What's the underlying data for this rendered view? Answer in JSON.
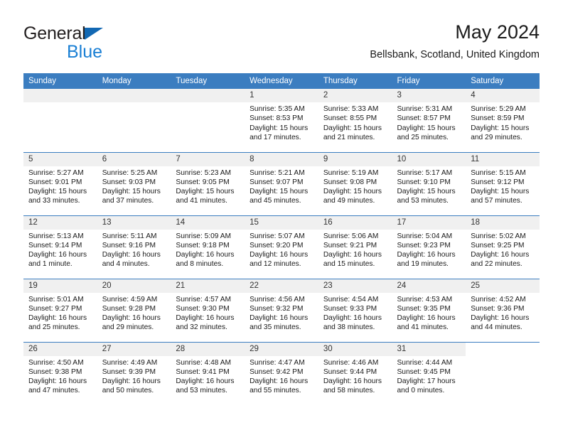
{
  "brand": {
    "name_part1": "General",
    "name_part2": "Blue",
    "triangle_color": "#1268b3",
    "blue_color": "#1a7fd4"
  },
  "header": {
    "title": "May 2024",
    "subtitle": "Bellsbank, Scotland, United Kingdom"
  },
  "theme": {
    "header_blue": "#3b7dc0",
    "daynum_bg": "#f0f0f0"
  },
  "calendar": {
    "weekday_headers": [
      "Sunday",
      "Monday",
      "Tuesday",
      "Wednesday",
      "Thursday",
      "Friday",
      "Saturday"
    ],
    "weeks": [
      [
        {
          "day": "",
          "empty": true
        },
        {
          "day": "",
          "empty": true
        },
        {
          "day": "",
          "empty": true
        },
        {
          "day": "1",
          "sunrise": "Sunrise: 5:35 AM",
          "sunset": "Sunset: 8:53 PM",
          "daylight": "Daylight: 15 hours and 17 minutes."
        },
        {
          "day": "2",
          "sunrise": "Sunrise: 5:33 AM",
          "sunset": "Sunset: 8:55 PM",
          "daylight": "Daylight: 15 hours and 21 minutes."
        },
        {
          "day": "3",
          "sunrise": "Sunrise: 5:31 AM",
          "sunset": "Sunset: 8:57 PM",
          "daylight": "Daylight: 15 hours and 25 minutes."
        },
        {
          "day": "4",
          "sunrise": "Sunrise: 5:29 AM",
          "sunset": "Sunset: 8:59 PM",
          "daylight": "Daylight: 15 hours and 29 minutes."
        }
      ],
      [
        {
          "day": "5",
          "sunrise": "Sunrise: 5:27 AM",
          "sunset": "Sunset: 9:01 PM",
          "daylight": "Daylight: 15 hours and 33 minutes."
        },
        {
          "day": "6",
          "sunrise": "Sunrise: 5:25 AM",
          "sunset": "Sunset: 9:03 PM",
          "daylight": "Daylight: 15 hours and 37 minutes."
        },
        {
          "day": "7",
          "sunrise": "Sunrise: 5:23 AM",
          "sunset": "Sunset: 9:05 PM",
          "daylight": "Daylight: 15 hours and 41 minutes."
        },
        {
          "day": "8",
          "sunrise": "Sunrise: 5:21 AM",
          "sunset": "Sunset: 9:07 PM",
          "daylight": "Daylight: 15 hours and 45 minutes."
        },
        {
          "day": "9",
          "sunrise": "Sunrise: 5:19 AM",
          "sunset": "Sunset: 9:08 PM",
          "daylight": "Daylight: 15 hours and 49 minutes."
        },
        {
          "day": "10",
          "sunrise": "Sunrise: 5:17 AM",
          "sunset": "Sunset: 9:10 PM",
          "daylight": "Daylight: 15 hours and 53 minutes."
        },
        {
          "day": "11",
          "sunrise": "Sunrise: 5:15 AM",
          "sunset": "Sunset: 9:12 PM",
          "daylight": "Daylight: 15 hours and 57 minutes."
        }
      ],
      [
        {
          "day": "12",
          "sunrise": "Sunrise: 5:13 AM",
          "sunset": "Sunset: 9:14 PM",
          "daylight": "Daylight: 16 hours and 1 minute."
        },
        {
          "day": "13",
          "sunrise": "Sunrise: 5:11 AM",
          "sunset": "Sunset: 9:16 PM",
          "daylight": "Daylight: 16 hours and 4 minutes."
        },
        {
          "day": "14",
          "sunrise": "Sunrise: 5:09 AM",
          "sunset": "Sunset: 9:18 PM",
          "daylight": "Daylight: 16 hours and 8 minutes."
        },
        {
          "day": "15",
          "sunrise": "Sunrise: 5:07 AM",
          "sunset": "Sunset: 9:20 PM",
          "daylight": "Daylight: 16 hours and 12 minutes."
        },
        {
          "day": "16",
          "sunrise": "Sunrise: 5:06 AM",
          "sunset": "Sunset: 9:21 PM",
          "daylight": "Daylight: 16 hours and 15 minutes."
        },
        {
          "day": "17",
          "sunrise": "Sunrise: 5:04 AM",
          "sunset": "Sunset: 9:23 PM",
          "daylight": "Daylight: 16 hours and 19 minutes."
        },
        {
          "day": "18",
          "sunrise": "Sunrise: 5:02 AM",
          "sunset": "Sunset: 9:25 PM",
          "daylight": "Daylight: 16 hours and 22 minutes."
        }
      ],
      [
        {
          "day": "19",
          "sunrise": "Sunrise: 5:01 AM",
          "sunset": "Sunset: 9:27 PM",
          "daylight": "Daylight: 16 hours and 25 minutes."
        },
        {
          "day": "20",
          "sunrise": "Sunrise: 4:59 AM",
          "sunset": "Sunset: 9:28 PM",
          "daylight": "Daylight: 16 hours and 29 minutes."
        },
        {
          "day": "21",
          "sunrise": "Sunrise: 4:57 AM",
          "sunset": "Sunset: 9:30 PM",
          "daylight": "Daylight: 16 hours and 32 minutes."
        },
        {
          "day": "22",
          "sunrise": "Sunrise: 4:56 AM",
          "sunset": "Sunset: 9:32 PM",
          "daylight": "Daylight: 16 hours and 35 minutes."
        },
        {
          "day": "23",
          "sunrise": "Sunrise: 4:54 AM",
          "sunset": "Sunset: 9:33 PM",
          "daylight": "Daylight: 16 hours and 38 minutes."
        },
        {
          "day": "24",
          "sunrise": "Sunrise: 4:53 AM",
          "sunset": "Sunset: 9:35 PM",
          "daylight": "Daylight: 16 hours and 41 minutes."
        },
        {
          "day": "25",
          "sunrise": "Sunrise: 4:52 AM",
          "sunset": "Sunset: 9:36 PM",
          "daylight": "Daylight: 16 hours and 44 minutes."
        }
      ],
      [
        {
          "day": "26",
          "sunrise": "Sunrise: 4:50 AM",
          "sunset": "Sunset: 9:38 PM",
          "daylight": "Daylight: 16 hours and 47 minutes."
        },
        {
          "day": "27",
          "sunrise": "Sunrise: 4:49 AM",
          "sunset": "Sunset: 9:39 PM",
          "daylight": "Daylight: 16 hours and 50 minutes."
        },
        {
          "day": "28",
          "sunrise": "Sunrise: 4:48 AM",
          "sunset": "Sunset: 9:41 PM",
          "daylight": "Daylight: 16 hours and 53 minutes."
        },
        {
          "day": "29",
          "sunrise": "Sunrise: 4:47 AM",
          "sunset": "Sunset: 9:42 PM",
          "daylight": "Daylight: 16 hours and 55 minutes."
        },
        {
          "day": "30",
          "sunrise": "Sunrise: 4:46 AM",
          "sunset": "Sunset: 9:44 PM",
          "daylight": "Daylight: 16 hours and 58 minutes."
        },
        {
          "day": "31",
          "sunrise": "Sunrise: 4:44 AM",
          "sunset": "Sunset: 9:45 PM",
          "daylight": "Daylight: 17 hours and 0 minutes."
        },
        {
          "day": "",
          "empty": true,
          "hidden": true
        }
      ]
    ]
  }
}
